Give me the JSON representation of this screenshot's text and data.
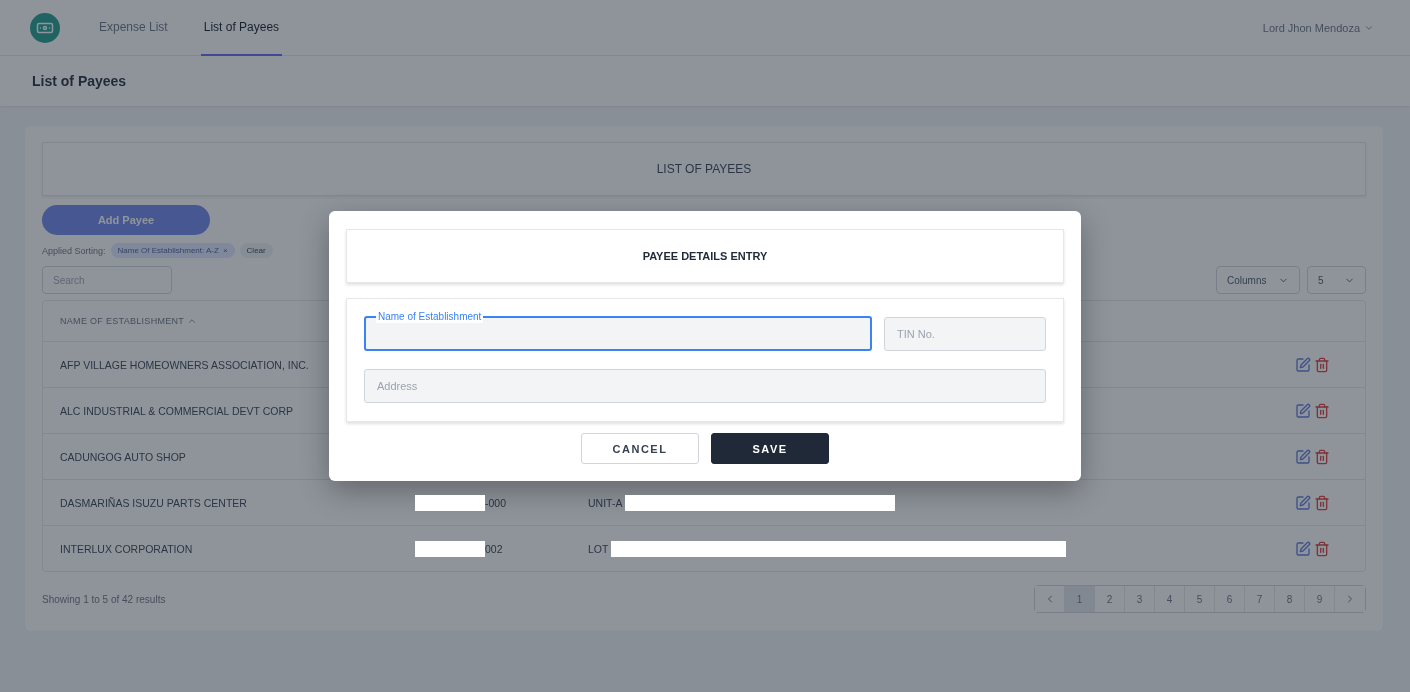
{
  "nav": {
    "items": [
      {
        "label": "Expense List",
        "selected": false
      },
      {
        "label": "List of Payees",
        "selected": true
      }
    ],
    "user": "Lord Jhon Mendoza"
  },
  "page_title": "List of Payees",
  "card": {
    "title": "LIST OF PAYEES",
    "add_button": "Add Payee",
    "sorting": {
      "label": "Applied Sorting:",
      "chips": [
        {
          "label": "Name Of Establishment: A-Z",
          "remove": "×"
        }
      ],
      "clear": "Clear"
    },
    "search": {
      "placeholder": "Search"
    },
    "columns_button": "Columns",
    "page_size": "5"
  },
  "table": {
    "columns": [
      {
        "label": "NAME OF ESTABLISHMENT",
        "sorted": true
      }
    ],
    "rows": [
      {
        "name": "AFP VILLAGE HOMEOWNERS ASSOCIATION, INC."
      },
      {
        "name": "ALC INDUSTRIAL & COMMERCIAL DEVT CORP"
      },
      {
        "name": "CADUNGOG AUTO SHOP"
      },
      {
        "name": "DASMARIÑAS ISUZU PARTS CENTER",
        "tin": "-000",
        "address": "UNIT-A",
        "redacted": true
      },
      {
        "name": "INTERLUX CORPORATION",
        "tin": "002",
        "address": "LOT",
        "redacted": true
      }
    ]
  },
  "footer": {
    "summary": "Showing 1 to 5 of 42 results",
    "pages": [
      {
        "label": "1",
        "selected": true
      },
      {
        "label": "2",
        "selected": false
      },
      {
        "label": "3",
        "selected": false
      },
      {
        "label": "4",
        "selected": false
      },
      {
        "label": "5",
        "selected": false
      },
      {
        "label": "6",
        "selected": false
      },
      {
        "label": "7",
        "selected": false
      },
      {
        "label": "8",
        "selected": false
      },
      {
        "label": "9",
        "selected": false
      }
    ]
  },
  "modal": {
    "title": "PAYEE DETAILS ENTRY",
    "fields": [
      {
        "label": "Name of Establishment",
        "focused": true
      },
      {
        "placeholder": "TIN No.",
        "focused": false
      },
      {
        "placeholder": "Address",
        "focused": false
      }
    ],
    "buttons": [
      {
        "label": "CANCEL",
        "kind": "secondary"
      },
      {
        "label": "SAVE",
        "kind": "primary"
      }
    ]
  }
}
